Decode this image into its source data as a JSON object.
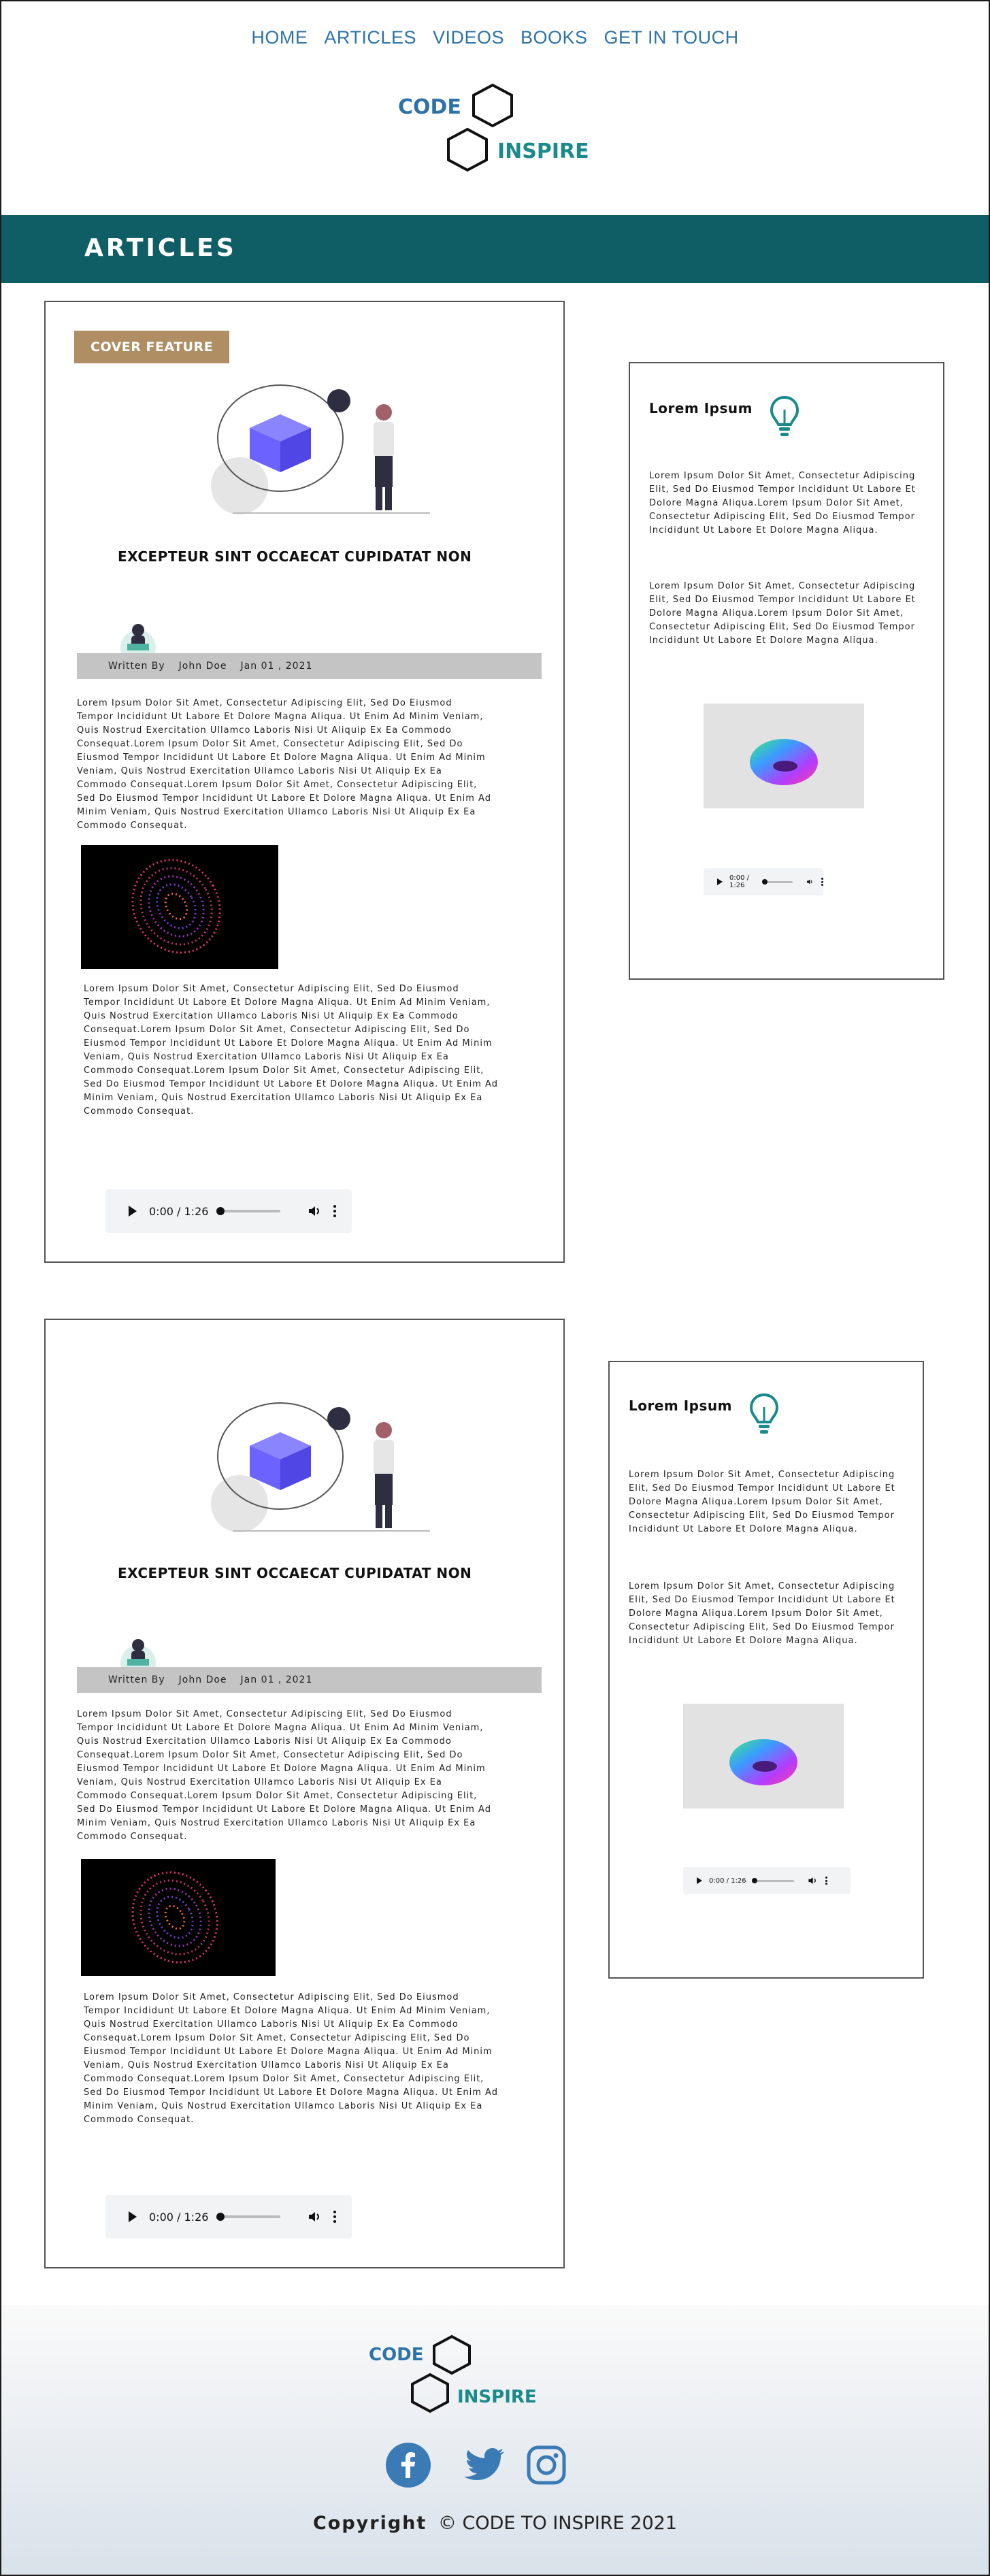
{
  "nav": {
    "items": [
      "HOME",
      "ARTICLES",
      "VIDEOS",
      "BOOKS",
      "GET IN TOUCH"
    ]
  },
  "logo": {
    "word1": "CODE",
    "word2": "INSPIRE"
  },
  "banner": {
    "title": "ARTICLES"
  },
  "articles": [
    {
      "badge": "COVER FEATURE",
      "title": "EXCEPTEUR SINT OCCAECAT CUPIDATAT NON",
      "byline": {
        "label": "Written By",
        "author": "John Doe",
        "date": "Jan 01 , 2021"
      },
      "para1": "Lorem Ipsum Dolor Sit Amet, Consectetur Adipiscing Elit, Sed Do Eiusmod Tempor Incididunt Ut Labore Et Dolore Magna Aliqua. Ut Enim Ad Minim Veniam, Quis Nostrud Exercitation Ullamco Laboris Nisi Ut Aliquip Ex Ea Commodo Consequat.Lorem Ipsum Dolor Sit Amet, Consectetur Adipiscing Elit, Sed Do Eiusmod Tempor Incididunt Ut Labore Et Dolore Magna Aliqua. Ut Enim Ad Minim Veniam, Quis Nostrud Exercitation Ullamco Laboris Nisi Ut Aliquip Ex Ea Commodo Consequat.Lorem Ipsum Dolor Sit Amet, Consectetur Adipiscing Elit, Sed Do Eiusmod Tempor Incididunt Ut Labore Et Dolore Magna Aliqua. Ut Enim Ad Minim Veniam, Quis Nostrud Exercitation Ullamco Laboris Nisi Ut Aliquip Ex Ea Commodo Consequat.",
      "para2": "Lorem Ipsum Dolor Sit Amet, Consectetur Adipiscing Elit, Sed Do Eiusmod Tempor Incididunt Ut Labore Et Dolore Magna Aliqua. Ut Enim Ad Minim Veniam, Quis Nostrud Exercitation Ullamco Laboris Nisi Ut Aliquip Ex Ea Commodo Consequat.Lorem Ipsum Dolor Sit Amet, Consectetur Adipiscing Elit, Sed Do Eiusmod Tempor Incididunt Ut Labore Et Dolore Magna Aliqua. Ut Enim Ad Minim Veniam, Quis Nostrud Exercitation Ullamco Laboris Nisi Ut Aliquip Ex Ea Commodo Consequat.Lorem Ipsum Dolor Sit Amet, Consectetur Adipiscing Elit, Sed Do Eiusmod Tempor Incididunt Ut Labore Et Dolore Magna Aliqua. Ut Enim Ad Minim Veniam, Quis Nostrud Exercitation Ullamco Laboris Nisi Ut Aliquip Ex Ea Commodo Consequat.",
      "audio_time": "0:00 / 1:26"
    },
    {
      "badge": "",
      "title": "EXCEPTEUR SINT OCCAECAT CUPIDATAT NON",
      "byline": {
        "label": "Written By",
        "author": "John Doe",
        "date": "Jan 01 , 2021"
      },
      "para1": "Lorem Ipsum Dolor Sit Amet, Consectetur Adipiscing Elit, Sed Do Eiusmod Tempor Incididunt Ut Labore Et Dolore Magna Aliqua. Ut Enim Ad Minim Veniam, Quis Nostrud Exercitation Ullamco Laboris Nisi Ut Aliquip Ex Ea Commodo Consequat.Lorem Ipsum Dolor Sit Amet, Consectetur Adipiscing Elit, Sed Do Eiusmod Tempor Incididunt Ut Labore Et Dolore Magna Aliqua. Ut Enim Ad Minim Veniam, Quis Nostrud Exercitation Ullamco Laboris Nisi Ut Aliquip Ex Ea Commodo Consequat.Lorem Ipsum Dolor Sit Amet, Consectetur Adipiscing Elit, Sed Do Eiusmod Tempor Incididunt Ut Labore Et Dolore Magna Aliqua. Ut Enim Ad Minim Veniam, Quis Nostrud Exercitation Ullamco Laboris Nisi Ut Aliquip Ex Ea Commodo Consequat.",
      "para2": "Lorem Ipsum Dolor Sit Amet, Consectetur Adipiscing Elit, Sed Do Eiusmod Tempor Incididunt Ut Labore Et Dolore Magna Aliqua. Ut Enim Ad Minim Veniam, Quis Nostrud Exercitation Ullamco Laboris Nisi Ut Aliquip Ex Ea Commodo Consequat.Lorem Ipsum Dolor Sit Amet, Consectetur Adipiscing Elit, Sed Do Eiusmod Tempor Incididunt Ut Labore Et Dolore Magna Aliqua. Ut Enim Ad Minim Veniam, Quis Nostrud Exercitation Ullamco Laboris Nisi Ut Aliquip Ex Ea Commodo Consequat.Lorem Ipsum Dolor Sit Amet, Consectetur Adipiscing Elit, Sed Do Eiusmod Tempor Incididunt Ut Labore Et Dolore Magna Aliqua. Ut Enim Ad Minim Veniam, Quis Nostrud Exercitation Ullamco Laboris Nisi Ut Aliquip Ex Ea Commodo Consequat.",
      "audio_time": "0:00 / 1:26"
    }
  ],
  "sidecards": [
    {
      "title": "Lorem Ipsum",
      "para1": "Lorem Ipsum Dolor Sit Amet, Consectetur Adipiscing Elit, Sed Do Eiusmod Tempor Incididunt Ut Labore Et Dolore Magna Aliqua.Lorem Ipsum Dolor Sit Amet, Consectetur Adipiscing Elit, Sed Do Eiusmod Tempor Incididunt Ut Labore Et Dolore Magna Aliqua.",
      "para2": "Lorem Ipsum Dolor Sit Amet, Consectetur Adipiscing Elit, Sed Do Eiusmod Tempor Incididunt Ut Labore Et Dolore Magna Aliqua.Lorem Ipsum Dolor Sit Amet, Consectetur Adipiscing Elit, Sed Do Eiusmod Tempor Incididunt Ut Labore Et Dolore Magna Aliqua.",
      "audio_time": "0:00 / 1:26"
    },
    {
      "title": "Lorem Ipsum",
      "para1": "Lorem Ipsum Dolor Sit Amet, Consectetur Adipiscing Elit, Sed Do Eiusmod Tempor Incididunt Ut Labore Et Dolore Magna Aliqua.Lorem Ipsum Dolor Sit Amet, Consectetur Adipiscing Elit, Sed Do Eiusmod Tempor Incididunt Ut Labore Et Dolore Magna Aliqua.",
      "para2": "Lorem Ipsum Dolor Sit Amet, Consectetur Adipiscing Elit, Sed Do Eiusmod Tempor Incididunt Ut Labore Et Dolore Magna Aliqua.Lorem Ipsum Dolor Sit Amet, Consectetur Adipiscing Elit, Sed Do Eiusmod Tempor Incididunt Ut Labore Et Dolore Magna Aliqua.",
      "audio_time": "0:00 / 1:26"
    }
  ],
  "footer": {
    "copyright_label": "Copyright",
    "copyright_symbol": "©",
    "copyright_text": "CODE TO INSPIRE  2021",
    "social": [
      "facebook-icon",
      "twitter-icon",
      "instagram-icon"
    ]
  },
  "colors": {
    "brand_blue": "#2e73a8",
    "brand_teal": "#1a8a8a",
    "banner_bg": "#0f5e66",
    "badge_bg": "#b08e63",
    "byline_bg": "#c4c4c4"
  }
}
